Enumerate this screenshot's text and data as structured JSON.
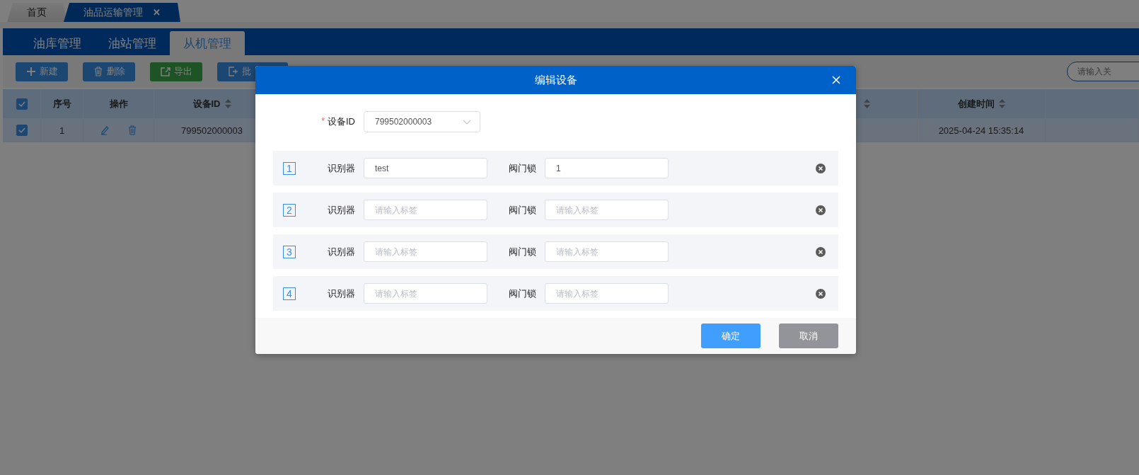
{
  "page_tabs": [
    {
      "label": "首页",
      "selected": false
    },
    {
      "label": "油品运输管理",
      "selected": true,
      "close": "✕"
    }
  ],
  "module_tabs": [
    {
      "label": "油库管理",
      "selected": false
    },
    {
      "label": "油站管理",
      "selected": false
    },
    {
      "label": "从机管理",
      "selected": true
    }
  ],
  "toolbar": [
    {
      "label": "新建",
      "kind": "add"
    },
    {
      "label": "删除",
      "kind": "delete"
    },
    {
      "label": "导出",
      "kind": "export"
    },
    {
      "label": "批",
      "kind": "import"
    }
  ],
  "search": {
    "placeholder": "请输入关"
  },
  "table": {
    "all_checked": true,
    "columns": [
      {
        "label": "序号",
        "sortable": false
      },
      {
        "label": "操作",
        "sortable": false
      },
      {
        "label": "设备ID",
        "sortable": true
      },
      {
        "sortable": true
      },
      {
        "label": "创建时间",
        "sortable": true
      }
    ],
    "rows": [
      {
        "checked": true,
        "selected": true,
        "index": "1",
        "device_id": "799502000003",
        "created": "2025-04-24 15:35:14"
      }
    ]
  },
  "dialog": {
    "title": "编辑设备",
    "device_field": {
      "required_mark": "*",
      "label": "设备ID",
      "value": "799502000003"
    },
    "rows": [
      {
        "index": "1",
        "identifier": {
          "label": "识别器",
          "value": "test"
        },
        "valve": {
          "label": "阀门锁",
          "value": "1"
        }
      },
      {
        "index": "2",
        "identifier": {
          "label": "识别器",
          "placeholder": "请输入标签"
        },
        "valve": {
          "label": "阀门锁",
          "placeholder": "请输入标签"
        }
      },
      {
        "index": "3",
        "identifier": {
          "label": "识别器",
          "placeholder": "请输入标签"
        },
        "valve": {
          "label": "阀门锁",
          "placeholder": "请输入标签"
        }
      },
      {
        "index": "4",
        "identifier": {
          "label": "识别器",
          "placeholder": "请输入标签"
        },
        "valve": {
          "label": "阀门锁",
          "placeholder": "请输入标签"
        }
      }
    ],
    "buttons": [
      {
        "label": "确定",
        "kind": "primary"
      },
      {
        "label": "取消",
        "kind": "secondary"
      }
    ]
  }
}
